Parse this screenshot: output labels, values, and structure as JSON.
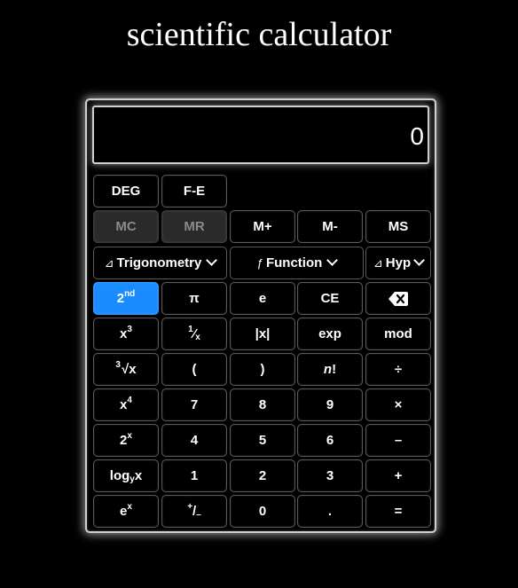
{
  "page": {
    "title": "scientific calculator"
  },
  "display": {
    "value": "0"
  },
  "mode_row": {
    "deg": "DEG",
    "fe": "F-E"
  },
  "memory_row": {
    "mc": "MC",
    "mr": "MR",
    "mplus": "M+",
    "mminus": "M-",
    "ms": "MS"
  },
  "dropdowns": {
    "trig": {
      "icon": "⊿",
      "label": "Trigonometry",
      "icon_name": "triangle-icon"
    },
    "func": {
      "icon": "ƒ",
      "label": "Function",
      "icon_name": "function-icon"
    },
    "hyp": {
      "icon": "⊿",
      "label": "Hyp",
      "icon_name": "triangle-icon"
    }
  },
  "keys": {
    "second": {
      "base": "2",
      "sup": "nd"
    },
    "pi": "π",
    "e": "e",
    "ce": "CE",
    "backspace": {
      "icon_name": "backspace-icon"
    },
    "cube": {
      "base": "x",
      "sup": "3"
    },
    "reciprocal": {
      "sup": "1",
      "slash": "⁄",
      "sub": "x"
    },
    "abs": "|x|",
    "exp": "exp",
    "mod": "mod",
    "cbrt": {
      "index": "3",
      "radical": "√",
      "base": "x"
    },
    "lparen": "(",
    "rparen": ")",
    "factorial": {
      "n": "n",
      "bang": "!"
    },
    "divide": "÷",
    "fourth": {
      "base": "x",
      "sup": "4"
    },
    "seven": "7",
    "eight": "8",
    "nine": "9",
    "multiply": "×",
    "two_pow_x": {
      "base": "2",
      "sup": "x"
    },
    "four": "4",
    "five": "5",
    "six": "6",
    "minus": "–",
    "log_y": {
      "pre": "log",
      "sub": "y",
      "post": "x"
    },
    "one": "1",
    "two": "2",
    "three": "3",
    "plus": "+",
    "e_pow_x": {
      "base": "e",
      "sup": "x"
    },
    "plus_minus": {
      "sup": "+",
      "slash": "/",
      "sub": "–"
    },
    "zero": "0",
    "dot": ".",
    "equals": "="
  },
  "colors": {
    "background": "#000000",
    "active_key": "#1a8cff",
    "disabled_key": "#2a2a2a"
  }
}
